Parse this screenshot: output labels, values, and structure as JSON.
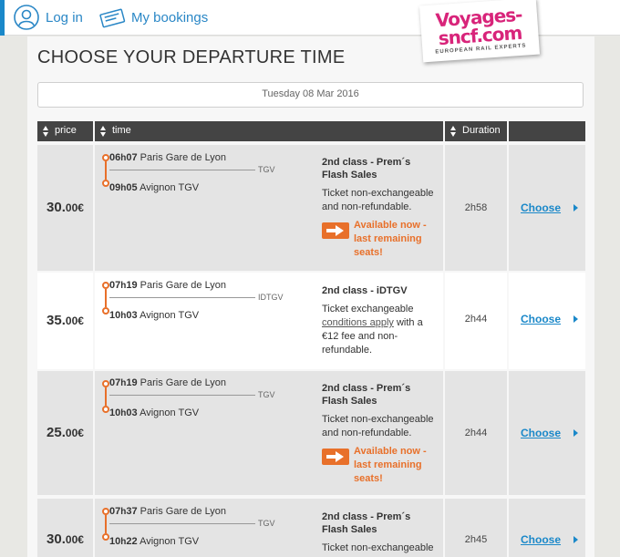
{
  "nav": {
    "login_label": "Log in",
    "bookings_label": "My bookings"
  },
  "logo": {
    "line1": "Voyages-",
    "line2": "sncf.com",
    "tagline": "EUROPEAN RAIL EXPERTS"
  },
  "page_title": "CHOOSE YOUR DEPARTURE TIME",
  "date": "Tuesday 08 Mar 2016",
  "columns": {
    "price": "price",
    "time": "time",
    "duration": "Duration"
  },
  "colors": {
    "accent_blue": "#1a88c9",
    "route_orange": "#e8702a",
    "brand_pink": "#d8247a",
    "header_dark": "#444444"
  },
  "journeys": [
    {
      "price_main": "30.",
      "price_dec": "00€",
      "dep_h": "06",
      "dep_m": "07",
      "dep_station": "Paris Gare de Lyon",
      "arr_h": "09",
      "arr_m": "05",
      "arr_station": "Avignon TGV",
      "train_type": "TGV",
      "class": "2nd class - Prem´s Flash Sales",
      "cond1": "Ticket non-exchangeable and non-refundable.",
      "availability": "Available now - last remaining seats!",
      "duration": "2h58",
      "choose": "Choose"
    },
    {
      "price_main": "35.",
      "price_dec": "00€",
      "dep_h": "07",
      "dep_m": "19",
      "dep_station": "Paris Gare de Lyon",
      "arr_h": "10",
      "arr_m": "03",
      "arr_station": "Avignon TGV",
      "train_type": "IDTGV",
      "class": "2nd class - iDTGV",
      "cond1": "Ticket exchangeable",
      "cond_link": "conditions apply",
      "cond2": "with a €12 fee and non-refundable.",
      "duration": "2h44",
      "choose": "Choose"
    },
    {
      "price_main": "25.",
      "price_dec": "00€",
      "dep_h": "07",
      "dep_m": "19",
      "dep_station": "Paris Gare de Lyon",
      "arr_h": "10",
      "arr_m": "03",
      "arr_station": "Avignon TGV",
      "train_type": "TGV",
      "class": "2nd class - Prem´s Flash Sales",
      "cond1": "Ticket non-exchangeable and non-refundable.",
      "availability": "Available now - last remaining seats!",
      "duration": "2h44",
      "choose": "Choose"
    },
    {
      "price_main": "30.",
      "price_dec": "00€",
      "dep_h": "07",
      "dep_m": "37",
      "dep_station": "Paris Gare de Lyon",
      "arr_h": "10",
      "arr_m": "22",
      "arr_station": "Avignon TGV",
      "train_type": "TGV",
      "class": "2nd class - Prem´s Flash Sales",
      "cond1": "Ticket non-exchangeable",
      "duration": "2h45",
      "choose": "Choose"
    }
  ]
}
